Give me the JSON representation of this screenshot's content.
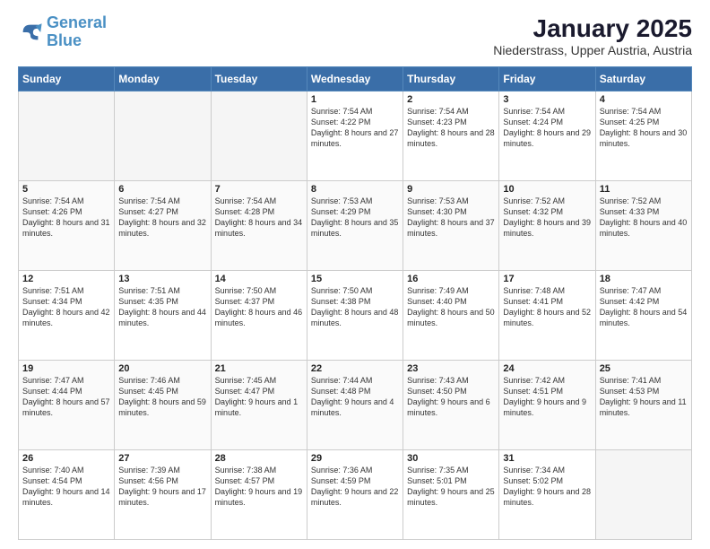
{
  "header": {
    "logo_line1": "General",
    "logo_line2": "Blue",
    "title": "January 2025",
    "subtitle": "Niederstrass, Upper Austria, Austria"
  },
  "weekdays": [
    "Sunday",
    "Monday",
    "Tuesday",
    "Wednesday",
    "Thursday",
    "Friday",
    "Saturday"
  ],
  "weeks": [
    [
      {
        "day": "",
        "info": ""
      },
      {
        "day": "",
        "info": ""
      },
      {
        "day": "",
        "info": ""
      },
      {
        "day": "1",
        "info": "Sunrise: 7:54 AM\nSunset: 4:22 PM\nDaylight: 8 hours and 27 minutes."
      },
      {
        "day": "2",
        "info": "Sunrise: 7:54 AM\nSunset: 4:23 PM\nDaylight: 8 hours and 28 minutes."
      },
      {
        "day": "3",
        "info": "Sunrise: 7:54 AM\nSunset: 4:24 PM\nDaylight: 8 hours and 29 minutes."
      },
      {
        "day": "4",
        "info": "Sunrise: 7:54 AM\nSunset: 4:25 PM\nDaylight: 8 hours and 30 minutes."
      }
    ],
    [
      {
        "day": "5",
        "info": "Sunrise: 7:54 AM\nSunset: 4:26 PM\nDaylight: 8 hours and 31 minutes."
      },
      {
        "day": "6",
        "info": "Sunrise: 7:54 AM\nSunset: 4:27 PM\nDaylight: 8 hours and 32 minutes."
      },
      {
        "day": "7",
        "info": "Sunrise: 7:54 AM\nSunset: 4:28 PM\nDaylight: 8 hours and 34 minutes."
      },
      {
        "day": "8",
        "info": "Sunrise: 7:53 AM\nSunset: 4:29 PM\nDaylight: 8 hours and 35 minutes."
      },
      {
        "day": "9",
        "info": "Sunrise: 7:53 AM\nSunset: 4:30 PM\nDaylight: 8 hours and 37 minutes."
      },
      {
        "day": "10",
        "info": "Sunrise: 7:52 AM\nSunset: 4:32 PM\nDaylight: 8 hours and 39 minutes."
      },
      {
        "day": "11",
        "info": "Sunrise: 7:52 AM\nSunset: 4:33 PM\nDaylight: 8 hours and 40 minutes."
      }
    ],
    [
      {
        "day": "12",
        "info": "Sunrise: 7:51 AM\nSunset: 4:34 PM\nDaylight: 8 hours and 42 minutes."
      },
      {
        "day": "13",
        "info": "Sunrise: 7:51 AM\nSunset: 4:35 PM\nDaylight: 8 hours and 44 minutes."
      },
      {
        "day": "14",
        "info": "Sunrise: 7:50 AM\nSunset: 4:37 PM\nDaylight: 8 hours and 46 minutes."
      },
      {
        "day": "15",
        "info": "Sunrise: 7:50 AM\nSunset: 4:38 PM\nDaylight: 8 hours and 48 minutes."
      },
      {
        "day": "16",
        "info": "Sunrise: 7:49 AM\nSunset: 4:40 PM\nDaylight: 8 hours and 50 minutes."
      },
      {
        "day": "17",
        "info": "Sunrise: 7:48 AM\nSunset: 4:41 PM\nDaylight: 8 hours and 52 minutes."
      },
      {
        "day": "18",
        "info": "Sunrise: 7:47 AM\nSunset: 4:42 PM\nDaylight: 8 hours and 54 minutes."
      }
    ],
    [
      {
        "day": "19",
        "info": "Sunrise: 7:47 AM\nSunset: 4:44 PM\nDaylight: 8 hours and 57 minutes."
      },
      {
        "day": "20",
        "info": "Sunrise: 7:46 AM\nSunset: 4:45 PM\nDaylight: 8 hours and 59 minutes."
      },
      {
        "day": "21",
        "info": "Sunrise: 7:45 AM\nSunset: 4:47 PM\nDaylight: 9 hours and 1 minute."
      },
      {
        "day": "22",
        "info": "Sunrise: 7:44 AM\nSunset: 4:48 PM\nDaylight: 9 hours and 4 minutes."
      },
      {
        "day": "23",
        "info": "Sunrise: 7:43 AM\nSunset: 4:50 PM\nDaylight: 9 hours and 6 minutes."
      },
      {
        "day": "24",
        "info": "Sunrise: 7:42 AM\nSunset: 4:51 PM\nDaylight: 9 hours and 9 minutes."
      },
      {
        "day": "25",
        "info": "Sunrise: 7:41 AM\nSunset: 4:53 PM\nDaylight: 9 hours and 11 minutes."
      }
    ],
    [
      {
        "day": "26",
        "info": "Sunrise: 7:40 AM\nSunset: 4:54 PM\nDaylight: 9 hours and 14 minutes."
      },
      {
        "day": "27",
        "info": "Sunrise: 7:39 AM\nSunset: 4:56 PM\nDaylight: 9 hours and 17 minutes."
      },
      {
        "day": "28",
        "info": "Sunrise: 7:38 AM\nSunset: 4:57 PM\nDaylight: 9 hours and 19 minutes."
      },
      {
        "day": "29",
        "info": "Sunrise: 7:36 AM\nSunset: 4:59 PM\nDaylight: 9 hours and 22 minutes."
      },
      {
        "day": "30",
        "info": "Sunrise: 7:35 AM\nSunset: 5:01 PM\nDaylight: 9 hours and 25 minutes."
      },
      {
        "day": "31",
        "info": "Sunrise: 7:34 AM\nSunset: 5:02 PM\nDaylight: 9 hours and 28 minutes."
      },
      {
        "day": "",
        "info": ""
      }
    ]
  ]
}
